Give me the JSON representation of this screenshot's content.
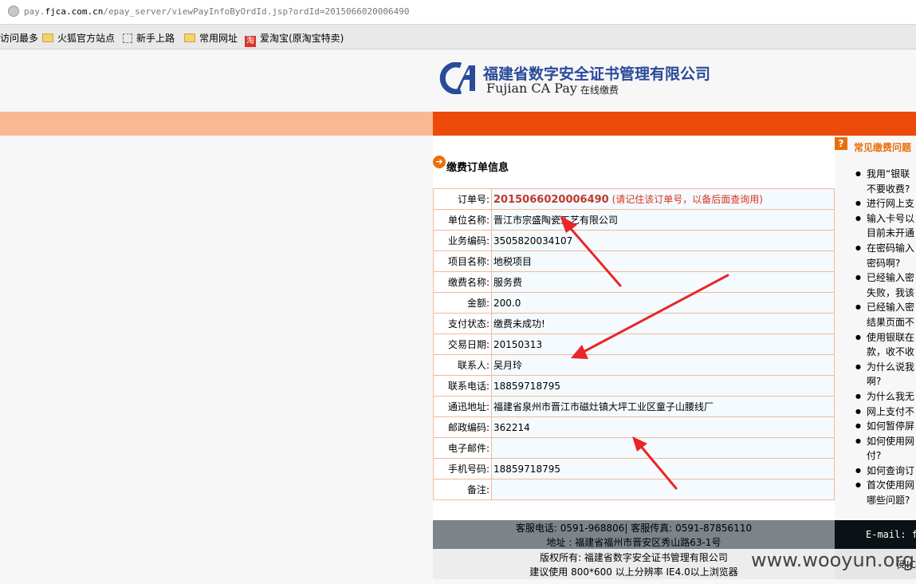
{
  "browser": {
    "url_prefix": "pay.",
    "url_domain": "fjca.com.cn",
    "url_path": "/epay_server/viewPayInfoByOrdId.jsp?ordId=2015066020006490",
    "bookmarks": [
      "访问最多",
      "火狐官方站点",
      "新手上路",
      "常用网址",
      "爱淘宝(原淘宝特卖)"
    ],
    "tao_icon": "淘"
  },
  "logo": {
    "name_cn": "福建省数字安全证书管理有限公司",
    "name_en": "Fujian CA Pay",
    "tagline": "在线缴费",
    "icon": "fjca-logo-icon"
  },
  "order": {
    "section_title": "缴费订单信息",
    "section_icon": "arrow-right-circle-icon",
    "order_no_label": "订单号:",
    "order_no": "2015066020006490",
    "order_no_note": "(请记住该订单号，以备后面查询用)",
    "rows": [
      {
        "label": "单位名称:",
        "value": "晋江市宗盛陶瓷工艺有限公司"
      },
      {
        "label": "业务编码:",
        "value": "3505820034107"
      },
      {
        "label": "项目名称:",
        "value": "地税项目"
      },
      {
        "label": "缴费名称:",
        "value": "服务费"
      },
      {
        "label": "金额:",
        "value": "200.0"
      },
      {
        "label": "支付状态:",
        "value": "缴费未成功!"
      },
      {
        "label": "交易日期:",
        "value": "20150313"
      },
      {
        "label": "联系人:",
        "value": "吴月玲"
      },
      {
        "label": "联系电话:",
        "value": "18859718795"
      },
      {
        "label": "通迅地址:",
        "value": "福建省泉州市晋江市磁灶镇大坪工业区童子山腰线厂"
      },
      {
        "label": "邮政编码:",
        "value": "362214"
      },
      {
        "label": "电子邮件:",
        "value": ""
      },
      {
        "label": "手机号码:",
        "value": "18859718795"
      },
      {
        "label": "备注:",
        "value": ""
      }
    ]
  },
  "footer": {
    "line1": "客服电话: 0591-968806| 客服传真: 0591-87856110",
    "line2": "地址 : 福建省福州市晋安区秀山路63-1号",
    "line3": "版权所有: 福建省数字安全证书管理有限公司",
    "line4": "建议使用 800*600 以上分辨率 IE4.0以上浏览器",
    "email_label": "E-mail: f",
    "tail": "阅IC"
  },
  "faq": {
    "icon": "question-icon",
    "title": "常见缴费问题",
    "items": [
      [
        "我用“银联",
        "不要收费?"
      ],
      [
        "进行网上支"
      ],
      [
        "输入卡号以",
        "目前未开通"
      ],
      [
        "在密码输入",
        "密码啊?"
      ],
      [
        "已经输入密",
        "失败，我该"
      ],
      [
        "已经输入密",
        "结果页面不"
      ],
      [
        "使用银联在",
        "款，收不收"
      ],
      [
        "为什么说我",
        "啊?"
      ],
      [
        "为什么我无"
      ],
      [
        "网上支付不"
      ],
      [
        "如何暂停屏"
      ],
      [
        "如何使用网",
        "付?"
      ],
      [
        "如何查询订"
      ],
      [
        "首次使用网",
        "哪些问题?"
      ]
    ]
  },
  "watermark": "www.wooyun.org",
  "colors": {
    "accent_orange": "#ec4a0a",
    "band_light": "#f9b893",
    "annotation_red": "#e8262a"
  }
}
